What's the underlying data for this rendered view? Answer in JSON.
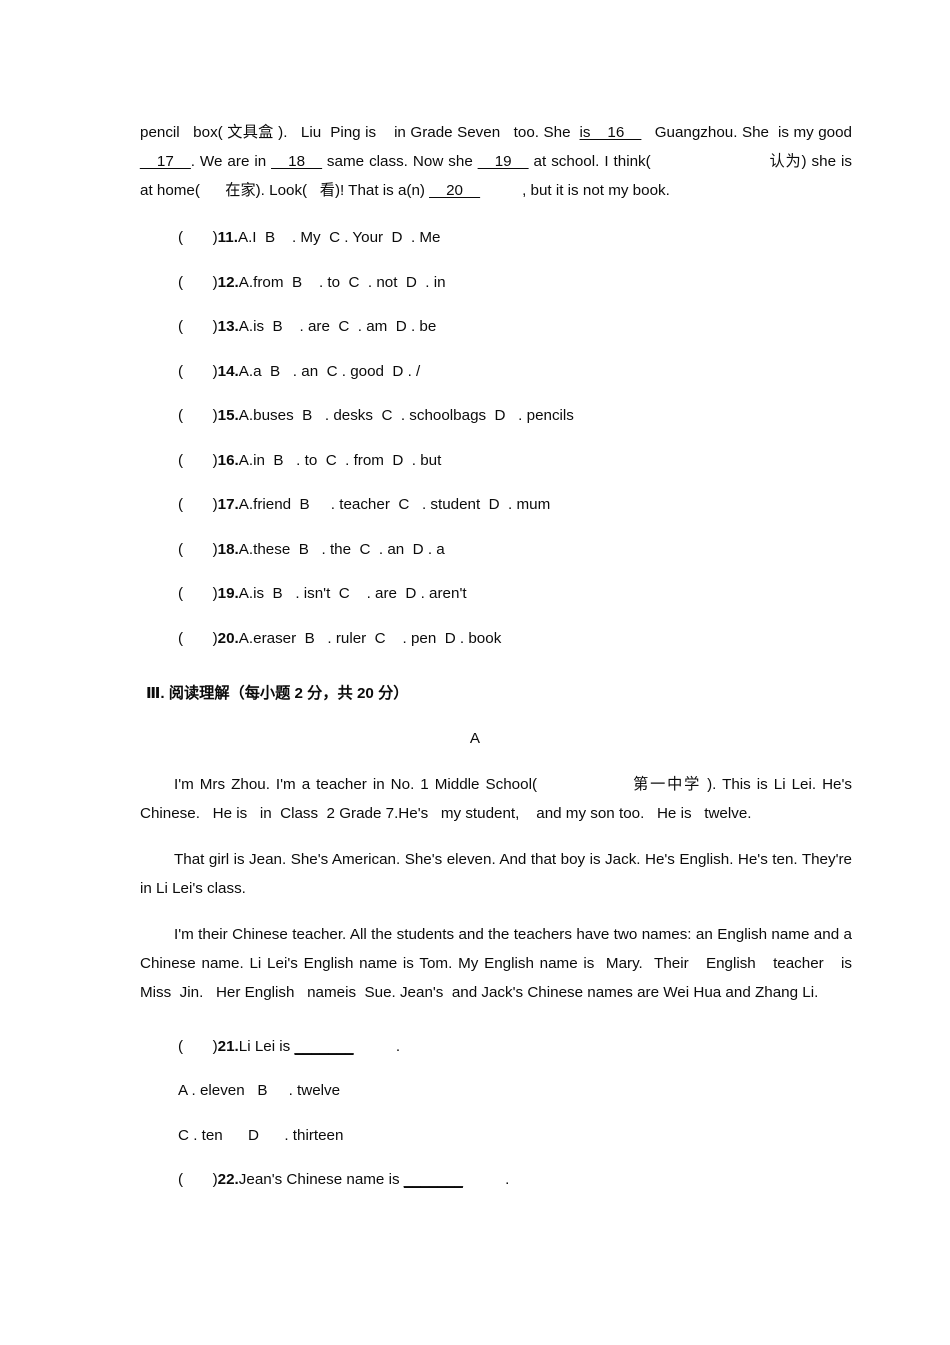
{
  "document": {
    "cloze_paragraph": {
      "segments": [
        {
          "text": "pencil   box( 文具盒 ).   Liu  Ping is    in Grade Seven   too. She  ",
          "style": "plain"
        },
        {
          "text": "is__16__",
          "style": "blank"
        },
        {
          "text": "   Guangzhou. She  is  my good ",
          "style": "plain"
        },
        {
          "text": "__17__",
          "style": "blank"
        },
        {
          "text": ". We are in ",
          "style": "plain"
        },
        {
          "text": "__18__",
          "style": "blank"
        },
        {
          "text": " same class. Now she ",
          "style": "plain"
        },
        {
          "text": "__19__",
          "style": "blank"
        },
        {
          "text": " at school. I think(                  认为) she is at home(      在家). Look(   看)! That is a(n) ",
          "style": "plain"
        },
        {
          "text": "__20__",
          "style": "blank"
        },
        {
          "text": "          , but it is not my book.",
          "style": "plain"
        }
      ],
      "line1": "pencil   box( 文具盒 ).   Liu  Ping is    in Grade Seven   too. She  ",
      "blank16": "is__16__",
      "after16": "   Guangzhou. She  is",
      "line2_start": "my good ",
      "blank17": "__17__",
      "after17": ". We are in ",
      "blank18": "__18__",
      "after18": " same class. Now she ",
      "blank19": "__19__",
      "after19": " at school. I think(",
      "line2_end": "认",
      "line3_start": "为) she is at home(      在家). Look(   看)! That is a(n) ",
      "blank20": "__20__",
      "line3_end": "          , but it is not my book."
    },
    "cloze_questions": [
      {
        "marker": "(       )",
        "number": "11.",
        "options": "A.I  B    . My  C . Your  D  . Me"
      },
      {
        "marker": "(       )",
        "number": "12.",
        "options": "A.from  B    . to  C  . not  D  . in"
      },
      {
        "marker": "(       )",
        "number": "13.",
        "options": "A.is  B    . are  C  . am  D . be"
      },
      {
        "marker": "(       )",
        "number": "14.",
        "options": "A.a  B   . an  C . good  D . /"
      },
      {
        "marker": "(       )",
        "number": "15.",
        "options": "A.buses  B   . desks  C  . schoolbags  D   . pencils"
      },
      {
        "marker": "(       )",
        "number": "16.",
        "options": "A.in  B   . to  C  . from  D  . but"
      },
      {
        "marker": "(       )",
        "number": "17.",
        "options": "A.friend  B     . teacher  C   . student  D  . mum"
      },
      {
        "marker": "(       )",
        "number": "18.",
        "options": "A.these  B   . the  C  . an  D . a"
      },
      {
        "marker": "(       )",
        "number": "19.",
        "options": "A.is  B   . isn't  C    . are  D . aren't"
      },
      {
        "marker": "(       )",
        "number": "20.",
        "options": "A.eraser  B   . ruler  C    . pen  D . book"
      }
    ],
    "section_heading": "Ⅲ. 阅读理解（每小题 2 分，共 20 分）",
    "passage_label": "A",
    "passage_paragraphs": [
      "I'm Mrs Zhou. I'm a teacher in No. 1 Middle School(                第一中学 ). This is Li Lei. He's  Chinese.   He is   in  Class  2 Grade 7.He's   my student,    and my son too.   He is   twelve.",
      "That girl is Jean. She's American. She's eleven. And that boy is Jack. He's English. He's ten. They're in Li Lei's class.",
      "I'm their Chinese teacher. All the students and the teachers have two names: an English name and a Chinese name. Li Lei's English name is Tom. My English name is  Mary.  Their   English   teacher   is  Miss  Jin.   Her English   nameis  Sue. Jean's  and Jack's Chinese names are Wei Hua and Zhang Li."
    ],
    "reading_questions": [
      {
        "marker": "(       )",
        "number": "21.",
        "stem_before": "Li Lei is ",
        "blank": "_______",
        "stem_after": "          .",
        "option_rows": [
          "A . eleven   B     . twelve",
          "C . ten      D      . thirteen"
        ]
      },
      {
        "marker": "(       )",
        "number": "22.",
        "stem_before": "Jean's Chinese name is ",
        "blank": "_______",
        "stem_after": "          .",
        "option_rows": []
      }
    ]
  }
}
